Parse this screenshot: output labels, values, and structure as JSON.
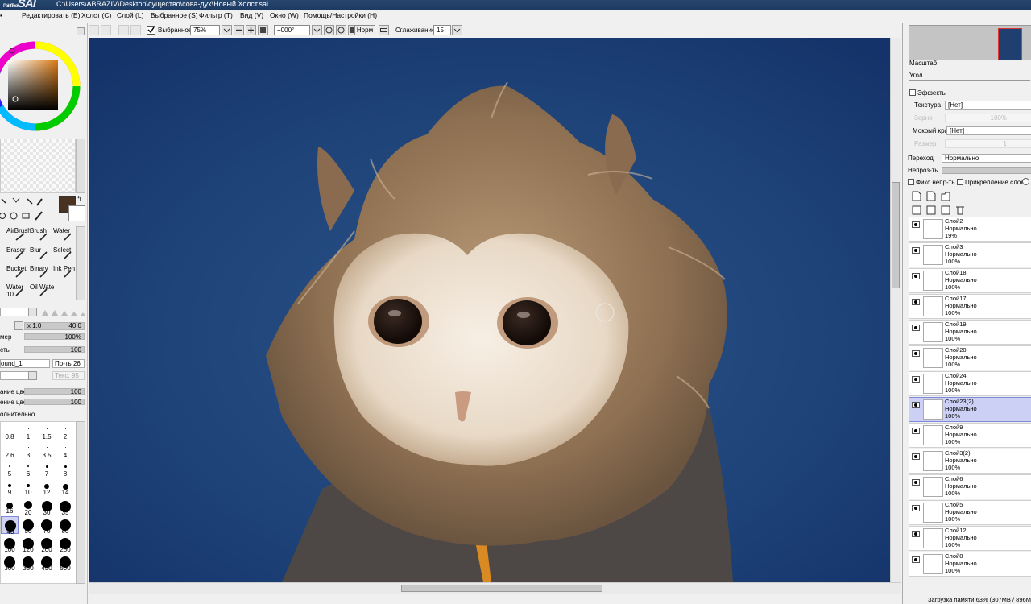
{
  "title_bar": {
    "logo": "SAI",
    "logo_sub": "PaintTool",
    "path": "C:\\Users\\ABRAZIV\\Desktop\\существо\\сова-дух\\Новый Холст.sai"
  },
  "menu": [
    "Редактировать (E)",
    "Холст (C)",
    "Слой (L)",
    "Выбранное (S)",
    "Фильтр (T)",
    "Вид (V)",
    "Окно (W)",
    "Помощь/Настройки (H)"
  ],
  "toolbar": {
    "selection_checkbox_label": "Выбранное",
    "zoom_value": "75%",
    "angle_value": "+000°",
    "blend_mode": "Норм",
    "smoothing_label": "Сглаживание",
    "smoothing_value": "15"
  },
  "tools": {
    "brush_slots": [
      "AirBrush",
      "Brush",
      "Water",
      "Eraser",
      "Blur",
      "Select",
      "Bucket",
      "Binary",
      "Ink Pen",
      "Water",
      "Oil Wate"
    ],
    "water_size": "10",
    "size_multiplier": "x 1.0",
    "size_value": "40.0",
    "min_size_label": "мер",
    "min_size_value": "100%",
    "density_label": "сть",
    "density_value": "100",
    "shape_name": "ound_1",
    "shape_strength_label": "Пр-ть",
    "shape_strength_value": "26",
    "texture_label": "Текс.",
    "texture_value": "95",
    "blending_label": "ание цве",
    "blending_value": "100",
    "dilution_label": "ение цвет",
    "dilution_value": "100",
    "advanced_label": "олнительно",
    "primary_color": "#4a3220",
    "secondary_color": "#ffffff"
  },
  "brush_sizes": [
    {
      "label": "0.8",
      "d": 1
    },
    {
      "label": "1",
      "d": 1
    },
    {
      "label": "1.5",
      "d": 1
    },
    {
      "label": "2",
      "d": 1
    },
    {
      "label": "2.6",
      "d": 1
    },
    {
      "label": "3",
      "d": 1
    },
    {
      "label": "3.5",
      "d": 1
    },
    {
      "label": "4",
      "d": 1
    },
    {
      "label": "5",
      "d": 2
    },
    {
      "label": "6",
      "d": 2
    },
    {
      "label": "7",
      "d": 3
    },
    {
      "label": "8",
      "d": 3
    },
    {
      "label": "9",
      "d": 4
    },
    {
      "label": "10",
      "d": 4
    },
    {
      "label": "12",
      "d": 6
    },
    {
      "label": "14",
      "d": 7
    },
    {
      "label": "16",
      "d": 8
    },
    {
      "label": "20",
      "d": 10
    },
    {
      "label": "30",
      "d": 13
    },
    {
      "label": "35",
      "d": 14
    },
    {
      "label": "40",
      "d": 14
    },
    {
      "label": "50",
      "d": 14
    },
    {
      "label": "70",
      "d": 14
    },
    {
      "label": "80",
      "d": 14
    },
    {
      "label": "100",
      "d": 14
    },
    {
      "label": "120",
      "d": 14
    },
    {
      "label": "200",
      "d": 14
    },
    {
      "label": "250",
      "d": 14
    },
    {
      "label": "300",
      "d": 14
    },
    {
      "label": "350",
      "d": 14
    },
    {
      "label": "450",
      "d": 14
    },
    {
      "label": "500",
      "d": 14
    }
  ],
  "navigator": {
    "zoom_label": "Масштаб",
    "angle_label": "Угол"
  },
  "effects": {
    "header": "Эффекты",
    "texture_label": "Текстура",
    "texture_value": "[Нет]",
    "grain_label": "Зерно",
    "grain_value": "100%",
    "wet_edge_label": "Мокрый край",
    "wet_edge_value": "[Нет]",
    "size_label": "Размер",
    "size_value": "1"
  },
  "layer_props": {
    "blend_label": "Переход",
    "blend_value": "Нормально",
    "opacity_label": "Непроз-ть",
    "fix_opacity_label": "Фикс непр-ть",
    "clipping_label": "Прикрепление слоя"
  },
  "layers": [
    {
      "name": "Слой2",
      "mode": "Нормально",
      "opacity": "19%",
      "selected": false
    },
    {
      "name": "Слой3",
      "mode": "Нормально",
      "opacity": "100%",
      "selected": false
    },
    {
      "name": "Слой18",
      "mode": "Нормально",
      "opacity": "100%",
      "selected": false
    },
    {
      "name": "Слой17",
      "mode": "Нормально",
      "opacity": "100%",
      "selected": false
    },
    {
      "name": "Слой19",
      "mode": "Нормально",
      "opacity": "100%",
      "selected": false
    },
    {
      "name": "Слой20",
      "mode": "Нормально",
      "opacity": "100%",
      "selected": false
    },
    {
      "name": "Слой24",
      "mode": "Нормально",
      "opacity": "100%",
      "selected": false
    },
    {
      "name": "Слой23(2)",
      "mode": "Нормально",
      "opacity": "100%",
      "selected": true
    },
    {
      "name": "Слой9",
      "mode": "Нормально",
      "opacity": "100%",
      "selected": false
    },
    {
      "name": "Слой3(2)",
      "mode": "Нормально",
      "opacity": "100%",
      "selected": false
    },
    {
      "name": "Слой6",
      "mode": "Нормально",
      "opacity": "100%",
      "selected": false
    },
    {
      "name": "Слой5",
      "mode": "Нормально",
      "opacity": "100%",
      "selected": false
    },
    {
      "name": "Слой12",
      "mode": "Нормально",
      "opacity": "100%",
      "selected": false
    },
    {
      "name": "Слой8",
      "mode": "Нормально",
      "opacity": "100%",
      "selected": false
    }
  ],
  "status": {
    "memory": "Загрузка памяти:63% (307MB / 896MB)"
  },
  "colors": {
    "canvas_bg": "#1b3e73",
    "selection": "#ccd0f5"
  }
}
